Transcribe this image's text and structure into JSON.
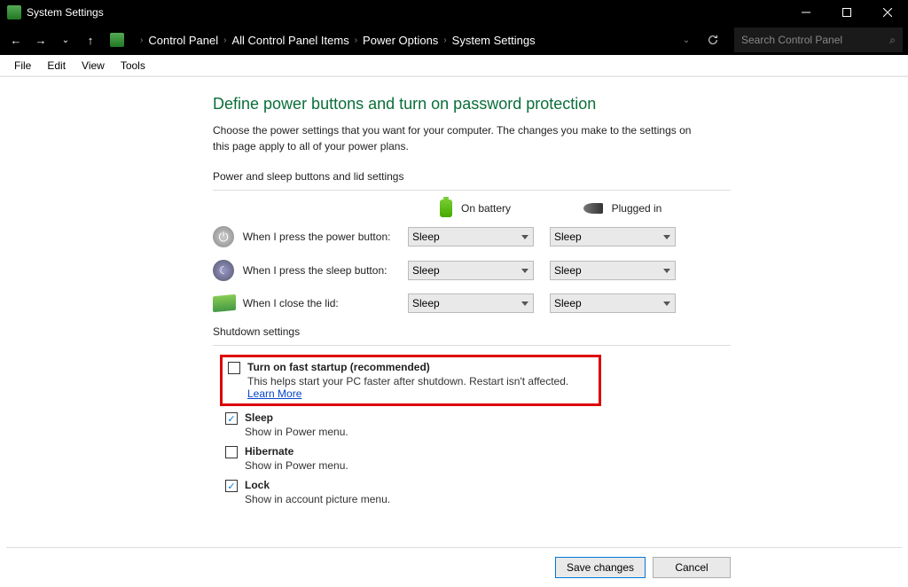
{
  "titlebar": {
    "title": "System Settings"
  },
  "nav": {
    "breadcrumb": [
      "Control Panel",
      "All Control Panel Items",
      "Power Options",
      "System Settings"
    ],
    "search_placeholder": "Search Control Panel"
  },
  "menu": {
    "items": [
      "File",
      "Edit",
      "View",
      "Tools"
    ]
  },
  "page": {
    "heading": "Define power buttons and turn on password protection",
    "intro": "Choose the power settings that you want for your computer. The changes you make to the settings on this page apply to all of your power plans.",
    "buttons_section_label": "Power and sleep buttons and lid settings",
    "col_battery": "On battery",
    "col_plugged": "Plugged in",
    "rows": [
      {
        "label": "When I press the power button:",
        "battery": "Sleep",
        "plugged": "Sleep"
      },
      {
        "label": "When I press the sleep button:",
        "battery": "Sleep",
        "plugged": "Sleep"
      },
      {
        "label": "When I close the lid:",
        "battery": "Sleep",
        "plugged": "Sleep"
      }
    ],
    "shutdown_section_label": "Shutdown settings",
    "shutdown": {
      "fast": {
        "checked": false,
        "label": "Turn on fast startup (recommended)",
        "desc": "This helps start your PC faster after shutdown. Restart isn't affected.",
        "learn": "Learn More"
      },
      "sleep": {
        "checked": true,
        "label": "Sleep",
        "desc": "Show in Power menu."
      },
      "hibernate": {
        "checked": false,
        "label": "Hibernate",
        "desc": "Show in Power menu."
      },
      "lock": {
        "checked": true,
        "label": "Lock",
        "desc": "Show in account picture menu."
      }
    },
    "save_btn": "Save changes",
    "cancel_btn": "Cancel"
  }
}
